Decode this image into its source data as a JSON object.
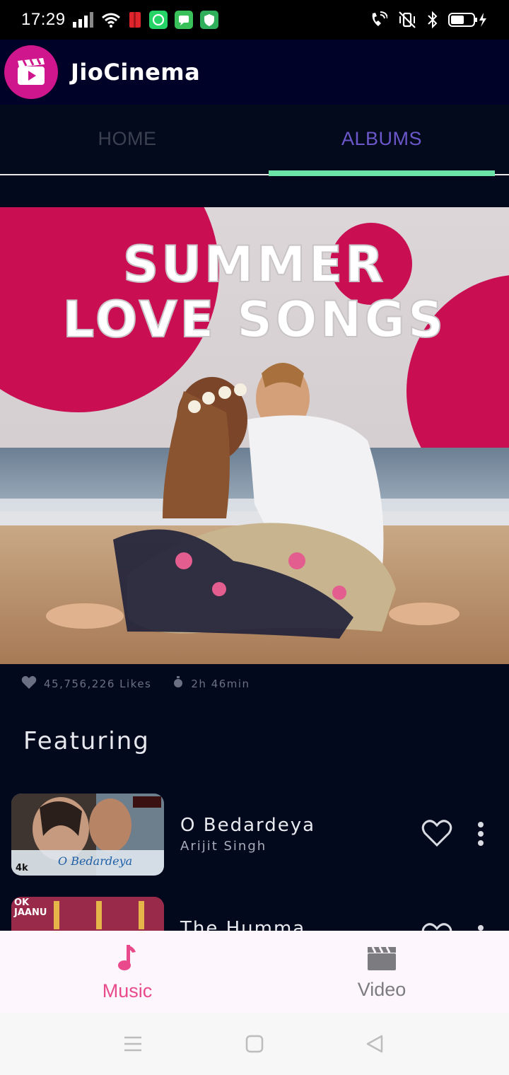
{
  "status_bar": {
    "time": "17:29"
  },
  "app": {
    "title": "JioCinema",
    "brand_color": "#d0168c"
  },
  "tabs": [
    {
      "label": "HOME",
      "selected": false
    },
    {
      "label": "ALBUMS",
      "selected": true
    }
  ],
  "banner": {
    "line1": "SUMMER",
    "line2": "LOVE SONGS"
  },
  "meta": {
    "likes": "45,756,226 Likes",
    "duration": "2h 46min"
  },
  "section_title": "Featuring",
  "songs": [
    {
      "title": "O Bedardeya",
      "artist": "Arijit Singh",
      "thumb_caption": "O Bedardeya",
      "thumb_badge": "4k"
    },
    {
      "title": "The Humma",
      "artist": "",
      "thumb_caption": "OK JAANU",
      "thumb_badge": ""
    }
  ],
  "bottom_nav": [
    {
      "label": "Music",
      "icon": "music-note-icon",
      "active": true
    },
    {
      "label": "Video",
      "icon": "clapperboard-icon",
      "active": false
    }
  ],
  "colors": {
    "tab_active": "#6b57c9",
    "tab_indicator": "#6ce3a7",
    "nav_active": "#e94a8b"
  }
}
